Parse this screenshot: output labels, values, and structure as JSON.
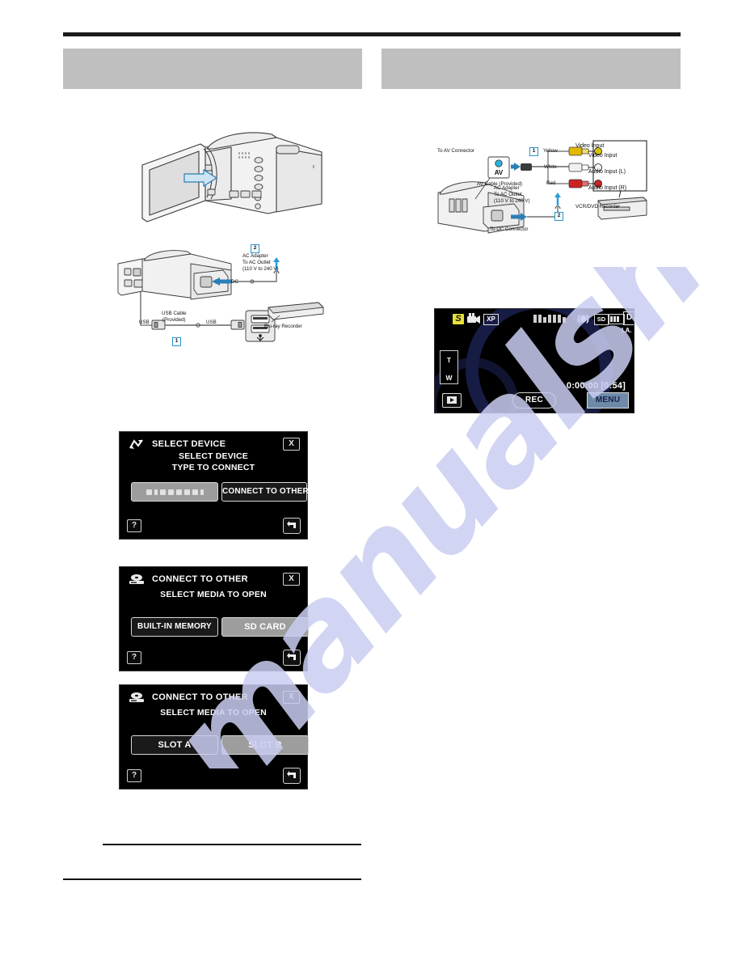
{
  "document": {
    "header_bars": {
      "left": "",
      "right": ""
    }
  },
  "figures": {
    "camcorder_open_lcd": {
      "name": "camcorder with LCD monitor opened"
    },
    "usb_connection": {
      "labels": {
        "ac_adapter": "AC Adapter\nTo AC Outlet\n(110 V to 240 V)",
        "dc": "DC",
        "usb_left": "USB",
        "usb_right": "USB",
        "usb_cable": "USB Cable\n(Provided)",
        "bluray_recorder": "Blu-ray Recorder"
      },
      "steps": {
        "usb": "1",
        "power": "2"
      }
    },
    "av_connection": {
      "labels": {
        "to_av_connector": "To AV Connector",
        "av_port": "AV",
        "av_cable": "AV Cable (Provided)",
        "yellow": "Yellow",
        "white": "White",
        "red": "Red",
        "video_input_title": "Video Input",
        "video_input": "Video Input",
        "audio_input_l": "Audio Input (L)",
        "audio_input_r": "Audio Input (R)",
        "vcr_dvd_recorder": "VCR/DVD Recorder",
        "ac_adapter": "AC Adapter\nTo AC Outlet\n(110 V to 240 V)",
        "to_dc_connector": "To DC Connector"
      },
      "steps": {
        "av": "1",
        "power": "2"
      }
    }
  },
  "screens": {
    "select_device": {
      "title": "SELECT DEVICE",
      "subtitle_line1": "SELECT DEVICE",
      "subtitle_line2": "TYPE TO CONNECT",
      "close_label": "X",
      "help_label": "?",
      "button_left_label": "",
      "button_right_label": "CONNECT TO OTHER",
      "icon_left": "usb-device-icon",
      "icon_close": "close-icon",
      "icon_help": "help-icon",
      "icon_back": "back-arrow-icon"
    },
    "connect_to_other_memory": {
      "title": "CONNECT TO OTHER",
      "subtitle": "SELECT MEDIA TO OPEN",
      "close_label": "X",
      "help_label": "?",
      "button_left_label": "BUILT-IN MEMORY",
      "button_right_label": "SD CARD",
      "icon_left": "disc-recorder-icon"
    },
    "connect_to_other_slots": {
      "title": "CONNECT TO OTHER",
      "subtitle": "SELECT MEDIA TO OPEN",
      "close_label": "X",
      "help_label": "?",
      "button_left_label": "SLOT A",
      "button_right_label": "SLOT B",
      "icon_left": "disc-recorder-icon"
    },
    "recording_screen": {
      "mode_badge": "S",
      "quality_badge": "XP",
      "stabilizer_icon": "(◉)",
      "sd_badge": "SD",
      "d_badge": "D",
      "ia_label": "I.A.",
      "zoom_tele": "T",
      "zoom_wide": "W",
      "timecode": "0:00:00  [0:54]",
      "rec_button_label": "REC",
      "menu_button_label": "MENU",
      "play_button_label": "play-icon"
    }
  },
  "watermark": {
    "text": "manualshive.com",
    "color": "#c9cdf0"
  },
  "colors": {
    "header_bar": "#bfbfbf",
    "rule": "#1b1b1b",
    "accent_blue": "#2196c9",
    "menu_button": "#6f8aa8",
    "badge_yellow": "#e6e03a"
  }
}
